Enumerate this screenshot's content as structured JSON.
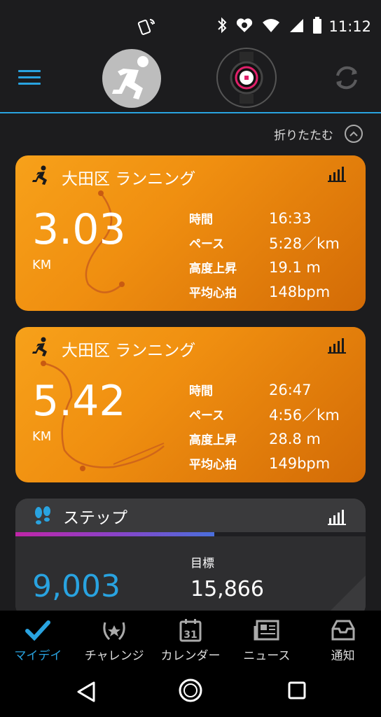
{
  "status": {
    "time": "11:12"
  },
  "header": {
    "menu": "menu",
    "sync": "sync"
  },
  "fold": {
    "label": "折りたたむ"
  },
  "runs": [
    {
      "title": "大田区 ランニング",
      "distance": "3.03",
      "unit": "KM",
      "stats": [
        {
          "label": "時間",
          "value": "16:33"
        },
        {
          "label": "ペース",
          "value": "5:28／km"
        },
        {
          "label": "高度上昇",
          "value": "19.1 m"
        },
        {
          "label": "平均心拍",
          "value": "148bpm"
        }
      ]
    },
    {
      "title": "大田区 ランニング",
      "distance": "5.42",
      "unit": "KM",
      "stats": [
        {
          "label": "時間",
          "value": "26:47"
        },
        {
          "label": "ペース",
          "value": "4:56／km"
        },
        {
          "label": "高度上昇",
          "value": "28.8 m"
        },
        {
          "label": "平均心拍",
          "value": "149bpm"
        }
      ]
    }
  ],
  "steps": {
    "title": "ステップ",
    "value": "9,003",
    "goal_label": "目標",
    "goal_value": "15,866",
    "progress": 0.567
  },
  "nav": [
    {
      "label": "マイデイ",
      "icon": "check-icon",
      "active": true
    },
    {
      "label": "チャレンジ",
      "icon": "laurel-icon",
      "active": false
    },
    {
      "label": "カレンダー",
      "icon": "calendar-icon",
      "active": false
    },
    {
      "label": "ニュース",
      "icon": "news-icon",
      "active": false
    },
    {
      "label": "通知",
      "icon": "inbox-icon",
      "active": false
    }
  ],
  "calendar_day": "31",
  "colors": {
    "accent": "#29a3e0",
    "run_card": "#f39a16",
    "step_value": "#29a3e0"
  }
}
